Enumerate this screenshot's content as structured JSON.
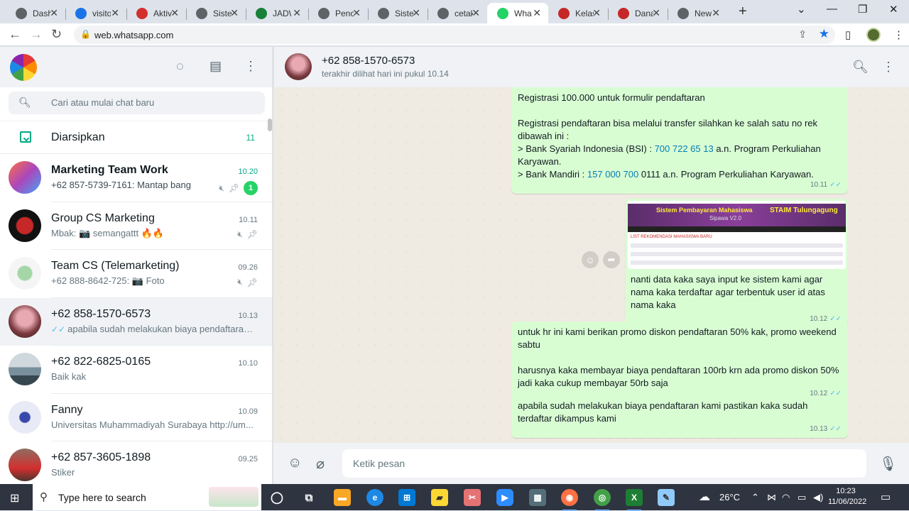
{
  "browser": {
    "tabs": [
      {
        "label": "Dash",
        "icon": "globe-icon",
        "color": "#5f6368"
      },
      {
        "label": "visito",
        "icon": "chat-icon",
        "color": "#1a73e8"
      },
      {
        "label": "Aktiv",
        "icon": "feather-icon",
        "color": "#d32f2f"
      },
      {
        "label": "Sistem",
        "icon": "globe-icon",
        "color": "#5f6368"
      },
      {
        "label": "JADW",
        "icon": "sheet-icon",
        "color": "#188038"
      },
      {
        "label": "Penc",
        "icon": "globe-icon",
        "color": "#5f6368"
      },
      {
        "label": "Sistem",
        "icon": "globe-icon",
        "color": "#5f6368"
      },
      {
        "label": "cetak",
        "icon": "globe-icon",
        "color": "#5f6368"
      },
      {
        "label": "Wha",
        "icon": "whatsapp-icon",
        "color": "#25d366"
      },
      {
        "label": "Kelas",
        "icon": "flag-icon",
        "color": "#c62828"
      },
      {
        "label": "Dana",
        "icon": "flag-icon",
        "color": "#c62828"
      },
      {
        "label": "New",
        "icon": "globe-icon",
        "color": "#5f6368"
      }
    ],
    "url": "web.whatsapp.com"
  },
  "sidebar": {
    "search_placeholder": "Cari atau mulai chat baru",
    "archived_label": "Diarsipkan",
    "archived_count": "11",
    "chats": [
      {
        "name": "Marketing Team Work",
        "time": "10.20",
        "last": "+62 857-5739-7161: Mantap bang",
        "unread": "1",
        "muted": true,
        "pinned": true,
        "bold": true
      },
      {
        "name": "Group CS Marketing",
        "time": "10.11",
        "last": "Mbak: 📷 semangattt 🔥🔥",
        "muted": true,
        "pinned": true
      },
      {
        "name": "Team CS (Telemarketing)",
        "time": "09.26",
        "last": "+62 888-8642-725: 📷 Foto",
        "muted": true,
        "pinned": true
      },
      {
        "name": "+62 858-1570-6573",
        "time": "10.13",
        "last": "apabila sudah melakukan biaya pendaftaran kami pastikan kaka sudah terdaftar dikampus kami",
        "ticks": "✓✓"
      },
      {
        "name": "+62 822-6825-0165",
        "time": "10.10",
        "last": "Baik kak"
      },
      {
        "name": "Fanny",
        "time": "10.09",
        "last": "Universitas Muhammadiyah Surabaya http://um..."
      },
      {
        "name": "+62 857-3605-1898",
        "time": "09.25",
        "last": "Stiker"
      }
    ]
  },
  "conversation": {
    "name": "+62 858-1570-6573",
    "status": "terakhir dilihat hari ini pukul 10.14",
    "msg1": {
      "line1": "Registrasi 100.000 untuk formulir pendaftaran",
      "line2": "Registrasi pendaftaran bisa melalui transfer silahkan ke salah satu no rek dibawah ini :",
      "bsi_pre": "> Bank Syariah Indonesia (BSI) : ",
      "bsi_num": "700 722 65 13",
      "bsi_post": " a.n. Program Perkuliahan Karyawan.",
      "mandiri_pre": "> Bank Mandiri : ",
      "mandiri_num": "157 000 700",
      "mandiri_post": " 0111 a.n. Program Perkuliahan Karyawan.",
      "time": "10.11"
    },
    "img_msg": {
      "shot_title": "Sistem Pembayaran Mahasiswa",
      "shot_org": "STAIM Tulungagung",
      "shot_sub": "Sipawa V2.0",
      "shot_section": "LIST REKOMENDASI MAHASISWA BARU",
      "caption": "nanti data kaka saya input ke sistem kami agar nama kaka terdaftar agar terbentuk user id atas nama kaka",
      "time": "10.12"
    },
    "msg3": {
      "p1": "untuk hr ini kami berikan promo diskon pendaftaran 50% kak, promo weekend sabtu",
      "p2": "harusnya kaka membayar biaya pendaftaran 100rb krn ada promo diskon 50% jadi kaka cukup membayar 50rb saja",
      "time": "10.12"
    },
    "msg4": {
      "text": "apabila sudah melakukan biaya pendaftaran kami pastikan kaka sudah terdaftar dikampus kami",
      "time": "10.13"
    },
    "input_placeholder": "Ketik pesan"
  },
  "taskbar": {
    "search_placeholder": "Type here to search",
    "temperature": "26°C",
    "time": "10:23",
    "date": "11/06/2022"
  }
}
